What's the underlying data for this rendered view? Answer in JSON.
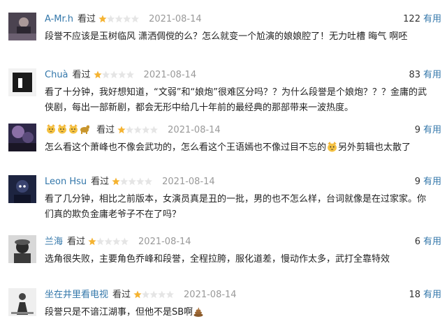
{
  "reviews": [
    {
      "user": "A-Mr.h",
      "status": "看过",
      "rating_stars": 1,
      "rating_max": 5,
      "date": "2021-08-14",
      "votes": "122",
      "useful_label": "有用",
      "content": "段誉不应该是玉树临风 潇洒倜傥的么？怎么就变一个尬演的娘娘腔了！无力吐槽 晦气 啊呸"
    },
    {
      "user": "Chuà",
      "status": "看过",
      "rating_stars": 1,
      "rating_max": 5,
      "date": "2021-08-14",
      "votes": "83",
      "useful_label": "有用",
      "content": "看了十分钟，我好想知道，“文弱”和“娘炮”很难区分吗？？为什么段誉是个娘炮？？？金庸的武侠剧，每出一部新剧，都会无形中给几十年前的最经典的那部带来一波热度。"
    },
    {
      "user": "",
      "status": "看过",
      "rating_stars": 1,
      "rating_max": 5,
      "date": "2021-08-14",
      "votes": "9",
      "useful_label": "有用",
      "content_before": "怎么看这个萧峰也不像会武功的，怎么看这个王语嫣也不像过目不忘的",
      "content_after": "另外剪辑也太散了"
    },
    {
      "user": "Leon Hsu",
      "status": "看过",
      "rating_stars": 1,
      "rating_max": 5,
      "date": "2021-08-14",
      "votes": "9",
      "useful_label": "有用",
      "content": "看了几分钟，相比之前版本，女演员真是丑的一批，男的也不怎么样，台词就像是在过家家。你们真的欺负金庸老爷子不在了吗？"
    },
    {
      "user": "兰海",
      "status": "看过",
      "rating_stars": 1,
      "rating_max": 5,
      "date": "2021-08-14",
      "votes": "6",
      "useful_label": "有用",
      "content": "选角很失败，主要角色乔峰和段誉，全程拉胯，服化道差，慢动作太多，武打全靠特效"
    },
    {
      "user": "坐在井里看电视",
      "status": "看过",
      "rating_stars": 1,
      "rating_max": 5,
      "date": "2021-08-14",
      "votes": "18",
      "useful_label": "有用",
      "content": "段誉只是不谙江湖事，但他不是SB啊"
    }
  ]
}
